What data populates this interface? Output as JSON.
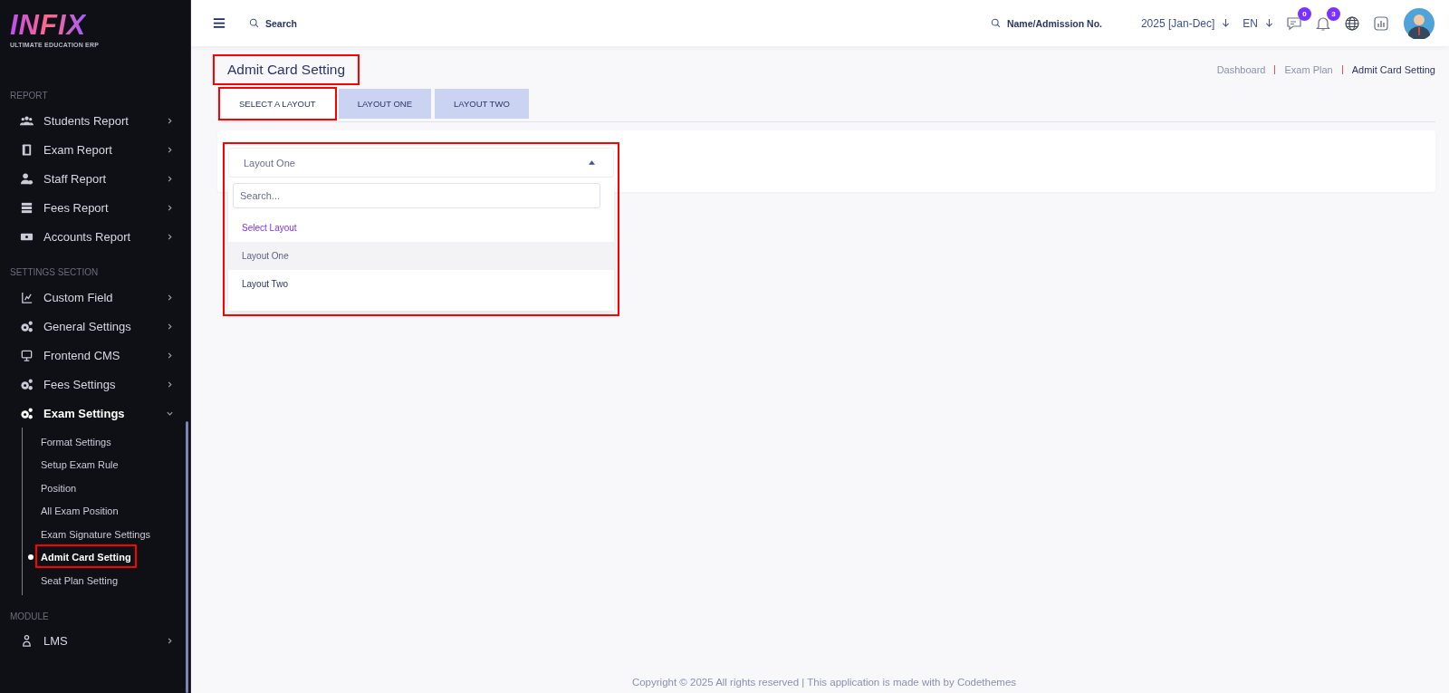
{
  "logo": {
    "name": "INFIX",
    "tagline": "ULTIMATE EDUCATION ERP"
  },
  "sidebar": {
    "sections": [
      {
        "heading": "REPORT",
        "items": [
          {
            "label": "Students Report",
            "expanded": false
          },
          {
            "label": "Exam Report",
            "expanded": false
          },
          {
            "label": "Staff Report",
            "expanded": false
          },
          {
            "label": "Fees Report",
            "expanded": false
          },
          {
            "label": "Accounts Report",
            "expanded": false
          }
        ]
      },
      {
        "heading": "SETTINGS SECTION",
        "items": [
          {
            "label": "Custom Field",
            "expanded": false
          },
          {
            "label": "General Settings",
            "expanded": false
          },
          {
            "label": "Frontend CMS",
            "expanded": false
          },
          {
            "label": "Fees Settings",
            "expanded": false
          },
          {
            "label": "Exam Settings",
            "expanded": true,
            "children": [
              {
                "label": "Format Settings",
                "selected": false,
                "annotated": false
              },
              {
                "label": "Setup Exam Rule",
                "selected": false,
                "annotated": false
              },
              {
                "label": "Position",
                "selected": false,
                "annotated": false
              },
              {
                "label": "All Exam Position",
                "selected": false,
                "annotated": false
              },
              {
                "label": "Exam Signature Settings",
                "selected": false,
                "annotated": false
              },
              {
                "label": "Admit Card Setting",
                "selected": true,
                "annotated": true
              },
              {
                "label": "Seat Plan Setting",
                "selected": false,
                "annotated": false
              }
            ]
          }
        ]
      },
      {
        "heading": "MODULE",
        "items": [
          {
            "label": "LMS",
            "expanded": false
          }
        ]
      }
    ]
  },
  "header": {
    "search": {
      "placeholder": "Search"
    },
    "student_search": {
      "placeholder": "Name/Admission No."
    },
    "session": "2025 [Jan-Dec]",
    "language": "EN",
    "message_count": "0",
    "notification_count": "3"
  },
  "page": {
    "title": "Admit Card Setting",
    "title_annotated": true,
    "breadcrumbs": [
      {
        "label": "Dashboard",
        "current": false
      },
      {
        "label": "Exam Plan",
        "current": false
      },
      {
        "label": "Admit Card Setting",
        "current": true
      }
    ]
  },
  "tabs": [
    {
      "label": "SELECT A LAYOUT",
      "selected": true,
      "annotated": true
    },
    {
      "label": "LAYOUT ONE",
      "selected": false,
      "annotated": false
    },
    {
      "label": "LAYOUT TWO",
      "selected": false,
      "annotated": false
    }
  ],
  "dropdown": {
    "value": "Layout One",
    "open": true,
    "annotated": true,
    "search_placeholder": "Search...",
    "options": [
      {
        "label": "Select Layout",
        "kind": "placeholder",
        "selected": false
      },
      {
        "label": "Layout One",
        "kind": "option",
        "selected": true
      },
      {
        "label": "Layout Two",
        "kind": "option",
        "selected": false
      }
    ]
  },
  "footer": "Copyright © 2025 All rights reserved | This application is made with by Codethemes"
}
